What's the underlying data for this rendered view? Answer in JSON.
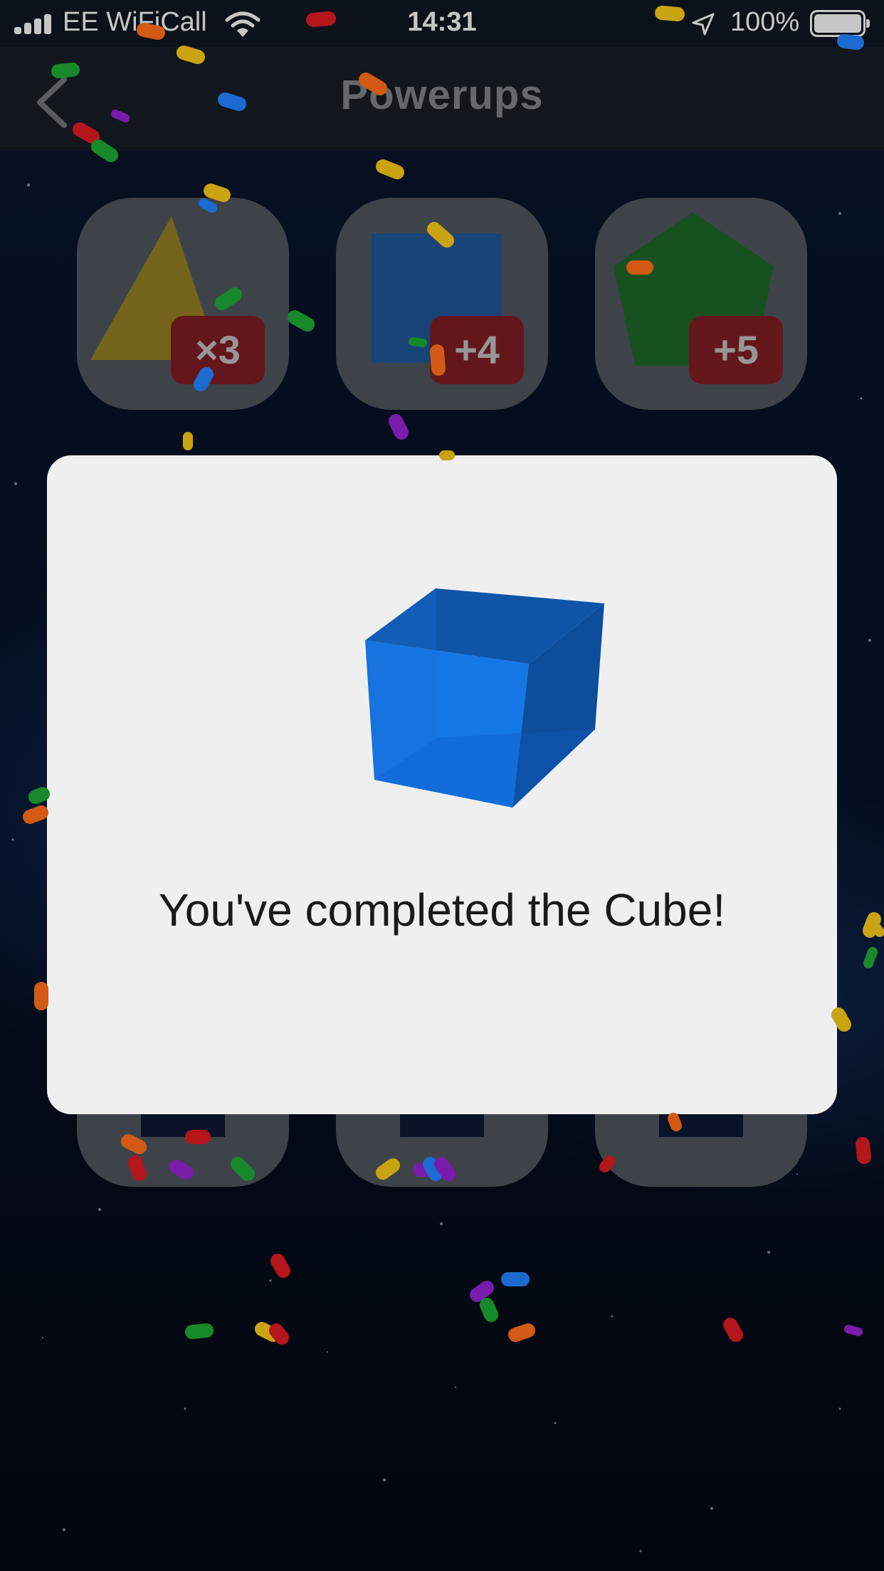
{
  "status_bar": {
    "carrier": "EE WiFiCall",
    "time": "14:31",
    "battery": "100%"
  },
  "nav": {
    "title": "Powerups",
    "back_icon": "chevron-left-icon"
  },
  "powerups": [
    {
      "shape": "triangle",
      "color": "#b8991b",
      "badge": "×3"
    },
    {
      "shape": "square",
      "color": "#1e5fa8",
      "badge": "+4"
    },
    {
      "shape": "pentagon",
      "color": "#1f7a28",
      "badge": "+5"
    }
  ],
  "modal": {
    "icon": "cube-icon",
    "message": "You've completed the Cube!"
  },
  "colors": {
    "background": "#061024",
    "modal": "#efeff0",
    "badge": "#7b1d22",
    "cube": "#1576e6"
  }
}
